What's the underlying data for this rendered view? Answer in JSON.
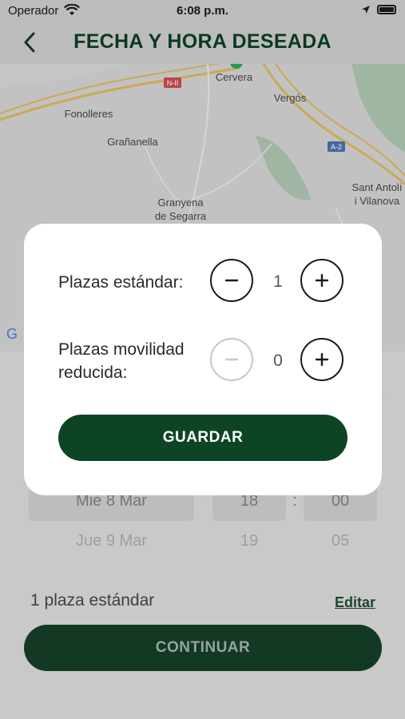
{
  "status_bar": {
    "carrier": "Operador",
    "time": "6:08 p.m."
  },
  "header": {
    "title": "FECHA Y HORA DESEADA",
    "back_icon": "chevron-left-icon"
  },
  "map": {
    "labels": [
      "Cervera",
      "Vergós",
      "Fonolleres",
      "Grañanella",
      "Granyena",
      "de Segarra",
      "Sant Antolí",
      "i Vilanova",
      "N-II",
      "A-2",
      "G"
    ]
  },
  "picker": {
    "date_selected": "Mié 8 Mar",
    "date_next": "Jue 9 Mar",
    "hour_selected": "18",
    "hour_next": "19",
    "separator": ":",
    "minute_selected": "00",
    "minute_next": "05"
  },
  "summary": {
    "text": "1 plaza estándar",
    "edit_label": "Editar"
  },
  "continue_label": "CONTINUAR",
  "modal": {
    "standard": {
      "label": "Plazas estándar:",
      "count": "1"
    },
    "reduced": {
      "label_line1": "Plazas movilidad",
      "label_line2": "reducida:",
      "count": "0"
    },
    "save_label": "GUARDAR"
  },
  "colors": {
    "brand_green": "#0d4524",
    "title_green": "#0c3d22",
    "overlay": "#000000"
  }
}
